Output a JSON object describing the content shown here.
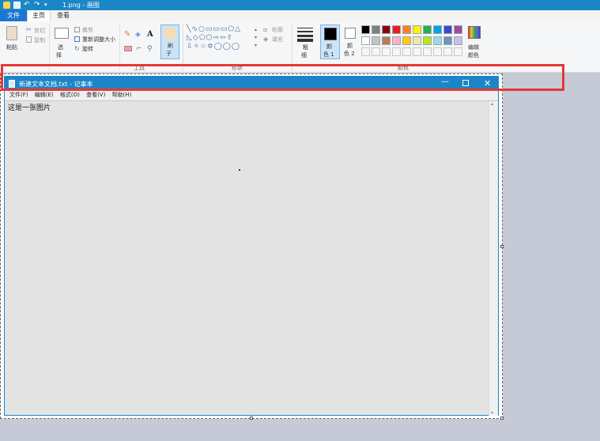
{
  "window": {
    "title": "1.png - 画图"
  },
  "tabs": [
    "文件",
    "主页",
    "查看"
  ],
  "ribbon": {
    "paste_label": "粘贴",
    "cut_label": "剪切",
    "copy_label": "复制",
    "select_label_1": "选",
    "select_label_2": "择",
    "crop_label": "裁剪",
    "resize_label": "重新调整大小",
    "rotate_label": "旋转",
    "brush_label_1": "刷",
    "brush_label_2": "子",
    "outline_label": "轮廓",
    "fill_label": "填充",
    "size_label_1": "粗",
    "size_label_2": "细",
    "color1_label_1": "颜",
    "color1_label_2": "色 1",
    "color2_label_1": "颜",
    "color2_label_2": "色 2",
    "edit_colors_label_1": "编辑",
    "edit_colors_label_2": "颜色",
    "groups": {
      "tools": "工具",
      "shapes": "形状",
      "colors": "颜色"
    }
  },
  "palette": [
    "#000000",
    "#7f7f7f",
    "#880015",
    "#ed1c24",
    "#ff7f27",
    "#fff200",
    "#22b14c",
    "#00a2e8",
    "#3f48cc",
    "#a349a4",
    "#ffffff",
    "#c3c3c3",
    "#b97a57",
    "#ffaec9",
    "#ffc90e",
    "#efe4b0",
    "#b5e61d",
    "#99d9ea",
    "#7092be",
    "#c8bfe7"
  ],
  "notepad": {
    "title": "新建文本文档.txt - 记事本",
    "menu": [
      "文件(F)",
      "编辑(E)",
      "格式(O)",
      "查看(V)",
      "帮助(H)"
    ],
    "content": "这是一张图片"
  }
}
